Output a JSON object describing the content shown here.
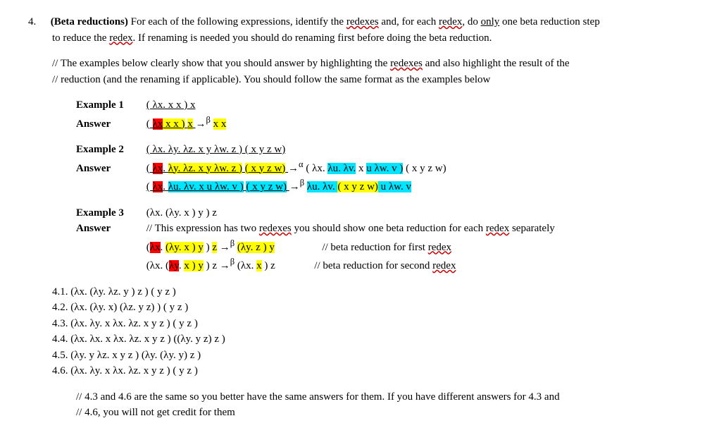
{
  "question_number": "4.",
  "title_bold": "(Beta reductions)",
  "title_rest_1": " For each of the following expressions, identify the ",
  "title_redexes": "redexes",
  "title_rest_2": " and, for each ",
  "title_redex": "redex",
  "title_rest_3": ", do ",
  "title_only": "only",
  "title_rest_4": " one beta reduction step",
  "intro_line2_a": "to reduce the ",
  "intro_line2_b": ". If renaming is needed you should do renaming first before doing the beta reduction.",
  "comment1_a": "// The examples below clearly show that you should answer by highlighting the ",
  "comment1_b": " and also highlight the result of the",
  "comment2": "// reduction (and the renaming if applicable). You should follow the same format as the examples below",
  "ex1_label": "Example 1",
  "ans_label": "Answer",
  "ex1_line1": "( λx.  x   x ) x",
  "ex1_ans_a": "( ",
  "ex1_ans_b": "λx",
  "ex1_ans_c": "   x   x )",
  "ex1_ans_d": "x",
  "ex1_ans_arrow": " →",
  "beta_sup": "β",
  "ex1_ans_e": " ",
  "ex1_ans_f": "x   x",
  "ex2_label": "Example 2",
  "ex2_line1": "( λx.  λy.  λz.  x    y  λw.  z ) ( x  y  z  w)",
  "ex2_a1": "( ",
  "ex2_a2": "λx",
  "ex2_a3": ".  ",
  "ex2_a4": "λy.  λz.  x    y  λw.  z )",
  "ex2_a5": " ",
  "ex2_a6": "( x  y  z  w)",
  "ex2_a_arrow": "  →",
  "alpha_sup": "α",
  "ex2_a7": "  ( λx.  ",
  "ex2_a8": "λu.  λv.",
  "ex2_a9": "  x    ",
  "ex2_a10": "u  λw.  v )",
  "ex2_a11": " ( x  y  z  w)",
  "ex2_b1": "( ",
  "ex2_b2": "λx",
  "ex2_b3": ".  ",
  "ex2_b4": "λu.  λv.  x    u  λw.  v )",
  "ex2_b5": " ",
  "ex2_b6": "( x  y  z  w)",
  "ex2_b_arrow": "  →",
  "ex2_b7": "   ",
  "ex2_b8": "λu.  λv.  ",
  "ex2_b9": "( x  y  z  w)",
  "ex2_b10": "   u  λw.  v",
  "ex3_label": "Example 3",
  "ex3_line1": "(λx.  (λy.  x ) y )   z",
  "ex3_comment_a": "// This expression has two ",
  "ex3_comment_b": " you should show one beta reduction for each ",
  "ex3_comment_c": " separately",
  "ex3_a1": "(",
  "ex3_a2": "λx",
  "ex3_a3": ".  ",
  "ex3_a4": "(λy.  x ) y",
  "ex3_a5": " )   ",
  "ex3_a6": "z",
  "ex3_a_arrow": "  →",
  "ex3_a7": " ",
  "ex3_a8": "(λy.  z ) y",
  "ex3_comment_first": "// beta reduction for first ",
  "ex3_b1": "(λx.  (",
  "ex3_b2": "λy",
  "ex3_b3": ".  ",
  "ex3_b4": "x ) y",
  "ex3_b5": " )   z  →",
  "ex3_b6": " (λx.  ",
  "ex3_b7": "x",
  "ex3_b8": " )   z",
  "ex3_comment_second": "// beta reduction for second ",
  "p41": "4.1.   (λx.   (λy.  λz.   y ) z ) ( y z )",
  "p42": "4.2.   (λx.   (λy.  x)   (λz.   y z) ) ( y z )",
  "p43": "4.3.   (λx.   λy.  x  λx.   λz.   x y z ) ( y z )",
  "p44": "4.4.   (λx.   λx.  x  λx.   λz.   x y z ) ((λy.   y z) z )",
  "p45": "4.5.   (λy.   y  λz.   x y z ) (λy.  (λy.   y) z )",
  "p46": "4.6.   (λx.   λy.  x  λx.   λz.   x y z ) ( y z )",
  "footnote1": "// 4.3 and 4.6 are the same so you better have the same answers for them. If you have different answers for 4.3 and",
  "footnote2": "// 4.6, you will not get credit for them"
}
